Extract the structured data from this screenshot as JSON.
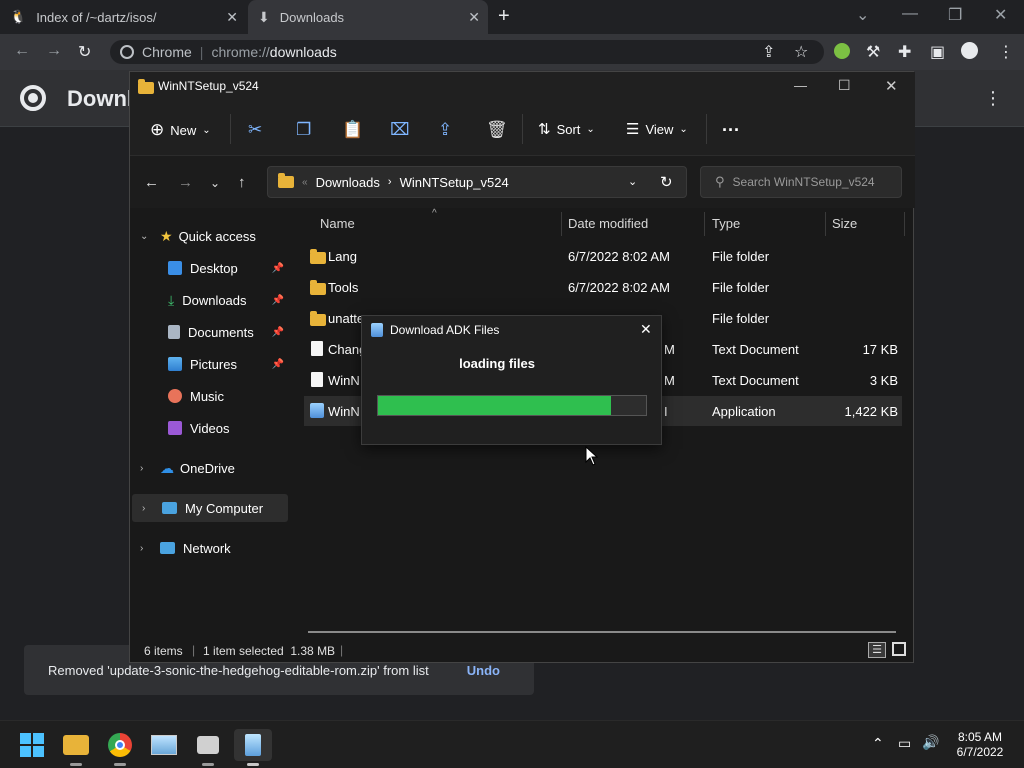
{
  "chrome": {
    "tabs": [
      {
        "title": "Index of /~dartz/isos/",
        "icon": "tux-icon"
      },
      {
        "title": "Downloads",
        "icon": "download-icon"
      }
    ],
    "omnibox": {
      "origin": "Chrome",
      "url_scheme": "chrome://",
      "url_path": "downloads"
    },
    "page_title": "Downl"
  },
  "explorer": {
    "title": "WinNTSetup_v524",
    "commands": {
      "new": "New",
      "sort": "Sort",
      "view": "View"
    },
    "address": {
      "parent": "Downloads",
      "current": "WinNTSetup_v524"
    },
    "search_placeholder": "Search WinNTSetup_v524",
    "sidebar": {
      "quick_access": "Quick access",
      "items": [
        {
          "label": "Desktop",
          "icon": "desktop-icon",
          "pinned": true
        },
        {
          "label": "Downloads",
          "icon": "downloads-icon",
          "pinned": true
        },
        {
          "label": "Documents",
          "icon": "documents-icon",
          "pinned": true
        },
        {
          "label": "Pictures",
          "icon": "pictures-icon",
          "pinned": true
        },
        {
          "label": "Music",
          "icon": "music-icon",
          "pinned": false
        },
        {
          "label": "Videos",
          "icon": "videos-icon",
          "pinned": false
        }
      ],
      "onedrive": "OneDrive",
      "my_computer": "My Computer",
      "network": "Network"
    },
    "columns": {
      "name": "Name",
      "date": "Date modified",
      "type": "Type",
      "size": "Size"
    },
    "files": [
      {
        "name": "Lang",
        "date": "6/7/2022 8:02 AM",
        "type": "File folder",
        "size": "",
        "kind": "folder"
      },
      {
        "name": "Tools",
        "date": "6/7/2022 8:02 AM",
        "type": "File folder",
        "size": "",
        "kind": "folder"
      },
      {
        "name": "unatte",
        "date": "",
        "type": "File folder",
        "size": "",
        "kind": "folder"
      },
      {
        "name": "Chang",
        "date": "M",
        "type": "Text Document",
        "size": "17 KB",
        "kind": "doc"
      },
      {
        "name": "WinN",
        "date": "M",
        "type": "Text Document",
        "size": "3 KB",
        "kind": "doc"
      },
      {
        "name": "WinN",
        "date": "I",
        "type": "Application",
        "size": "1,422 KB",
        "kind": "app"
      }
    ],
    "status": {
      "items": "6 items",
      "selected": "1 item selected  1.38 MB"
    }
  },
  "dialog": {
    "title": "Download ADK Files",
    "status": "loading files",
    "progress": 0.87,
    "colors": {
      "progress": "#2fbf4f"
    }
  },
  "snackbar": {
    "message": "Removed 'update-3-sonic-the-hedgehog-editable-rom.zip' from list",
    "action": "Undo"
  },
  "taskbar": {
    "apps": [
      "start-icon",
      "file-explorer-icon",
      "chrome-icon",
      "photos-icon",
      "installer-icon",
      "setup-app-icon"
    ],
    "time": "8:05 AM",
    "date": "6/7/2022"
  }
}
